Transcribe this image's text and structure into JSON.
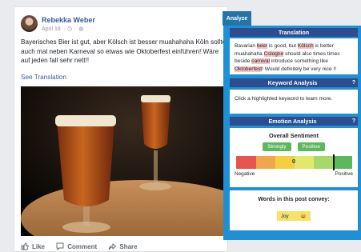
{
  "post": {
    "author": "Rebekka Weber",
    "date": "April 16",
    "text": "Bayerisches Bier ist gut, aber Kölsch ist besser muahahaha Köln sollte auch mal neben Karneval so etwas wie Oktoberfest einführen! Wäre auf jeden fall sehr nett!!",
    "see_translation": "See Translation",
    "actions": {
      "like": "Like",
      "comment": "Comment",
      "share": "Share"
    }
  },
  "analyze": {
    "tab_label": "Analyze",
    "translation": {
      "title": "Translation",
      "segments": [
        {
          "text": "Bavarian ",
          "hl": false
        },
        {
          "text": "beer",
          "hl": true
        },
        {
          "text": " is good, but ",
          "hl": false
        },
        {
          "text": "Kölsch",
          "hl": true
        },
        {
          "text": " is better muahahaha ",
          "hl": false
        },
        {
          "text": "Cologne",
          "hl": true
        },
        {
          "text": " should also times times beside ",
          "hl": false
        },
        {
          "text": "carnival",
          "hl": true
        },
        {
          "text": " introduce something like ",
          "hl": false
        },
        {
          "text": "Oktoberfest",
          "hl": true
        },
        {
          "text": "! Would definitely be very nice !!",
          "hl": false
        }
      ]
    },
    "keyword": {
      "title": "Keyword Analysis",
      "help": "?",
      "hint": "Click a highlighted keyword to learn more."
    },
    "emotion": {
      "title": "Emotion Analysis",
      "help": "?",
      "sentiment_title": "Overall Sentiment",
      "strength": "Strongly",
      "polarity": "Positive",
      "bar_value": "0",
      "marker_fraction": 0.84,
      "negative_label": "Negative",
      "positive_label": "Positive",
      "colors": [
        "#e8544e",
        "#f0a64b",
        "#f4d03f",
        "#e2e86b",
        "#a6d86a",
        "#5cb85c"
      ]
    },
    "convey": {
      "title": "Words in this post convey:",
      "emotion": "Joy",
      "emoji": "😄"
    }
  }
}
